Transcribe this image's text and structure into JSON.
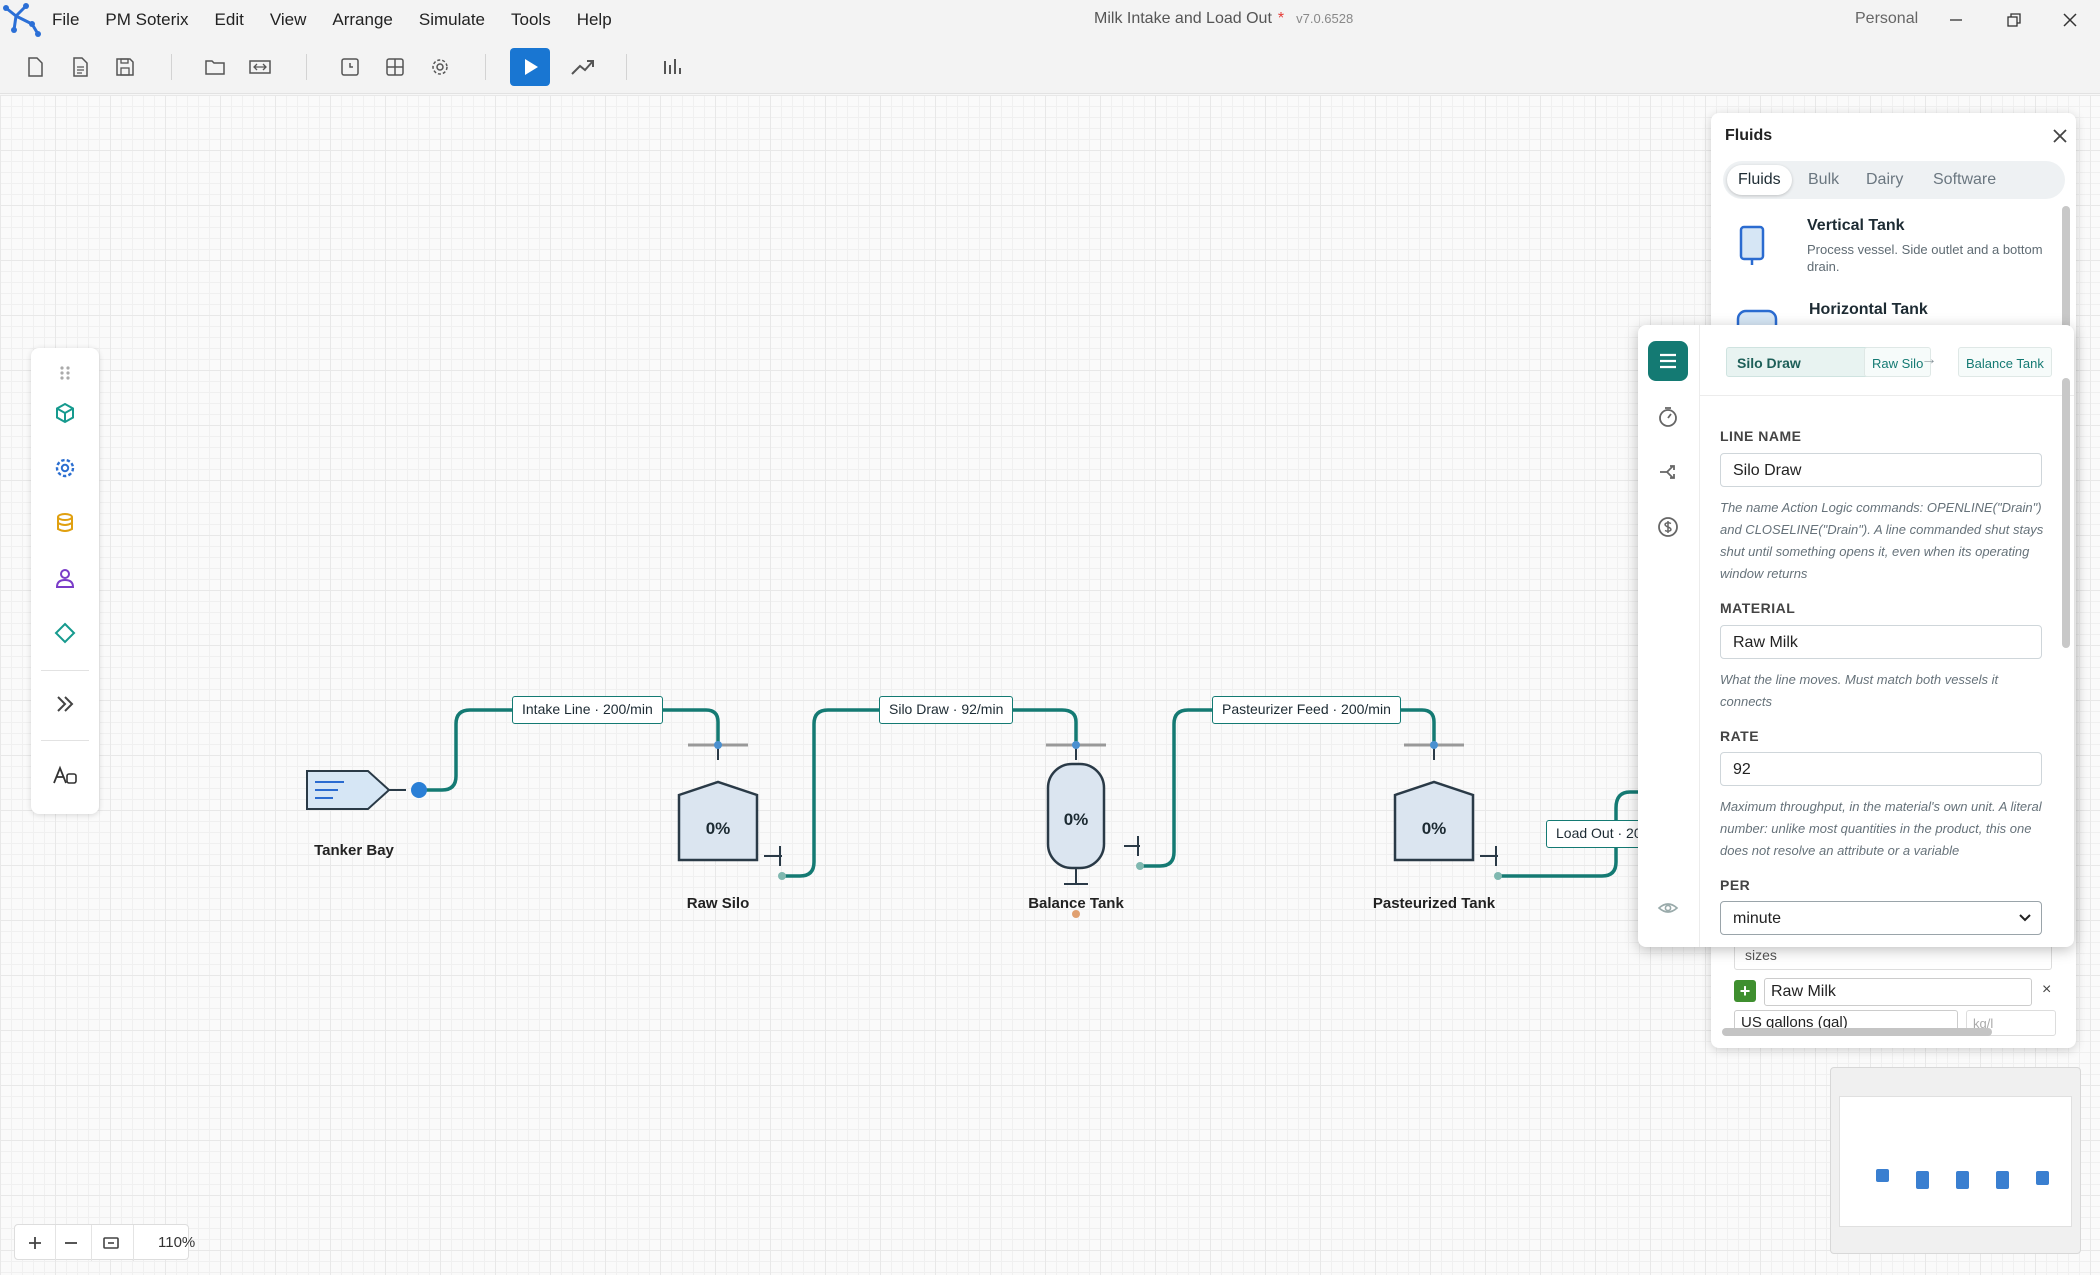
{
  "app": {
    "menu": [
      "File",
      "PM Soterix",
      "Edit",
      "View",
      "Arrange",
      "Simulate",
      "Tools",
      "Help"
    ],
    "title": "Milk Intake and Load Out",
    "dirty_marker": "*",
    "version": "v7.0.6528",
    "account": "Personal"
  },
  "toolbar": {
    "buttons": [
      "new-file",
      "new-document",
      "save",
      "open-folder",
      "import",
      "timer",
      "grid",
      "settings",
      "run-simulation",
      "trend-chart",
      "bar-chart"
    ],
    "accent_color": "#1976d2"
  },
  "palette": {
    "items": [
      "cube-icon",
      "gear-icon",
      "database-icon",
      "person-icon",
      "diamond-icon",
      "double-chevron-icon",
      "text-style-icon"
    ]
  },
  "flow": {
    "line_color": "#147a73",
    "nodes": [
      {
        "label": "Tanker Bay"
      },
      {
        "label": "Raw Silo",
        "level": "0%"
      },
      {
        "label": "Balance Tank",
        "level": "0%"
      },
      {
        "label": "Pasteurized Tank",
        "level": "0%"
      }
    ],
    "lines": [
      {
        "label": "Intake Line · 200/min"
      },
      {
        "label": "Silo Draw · 92/min"
      },
      {
        "label": "Pasteurizer Feed · 200/min"
      },
      {
        "label": "Load Out · 20"
      }
    ]
  },
  "fluids_panel": {
    "title": "Fluids",
    "tabs": [
      "Fluids",
      "Bulk",
      "Dairy",
      "Software"
    ],
    "active_tab": "Fluids",
    "shapes": [
      {
        "name": "Vertical Tank",
        "description": "Process vessel. Side outlet and a bottom drain."
      },
      {
        "name": "Horizontal Tank",
        "description": ""
      }
    ],
    "sub": {
      "sizes_label": "sizes",
      "material_value": "Raw Milk",
      "remove": "×",
      "unit_select": "US gallons (gal)",
      "density_placeholder": "kg/l"
    }
  },
  "inspector": {
    "line_name_chip": "Silo Draw",
    "from": "Raw Silo",
    "arrow": "→",
    "to": "Balance Tank",
    "fields": {
      "line_name_label": "LINE NAME",
      "line_name_value": "Silo Draw",
      "line_name_help": "The name Action Logic commands: OPENLINE(\"Drain\") and CLOSELINE(\"Drain\"). A line commanded shut stays shut until something opens it, even when its operating window returns",
      "material_label": "MATERIAL",
      "material_value": "Raw Milk",
      "material_help": "What the line moves. Must match both vessels it connects",
      "rate_label": "RATE",
      "rate_value": "92",
      "rate_help": "Maximum throughput, in the material's own unit. A literal number: unlike most quantities in the product, this one does not resolve an attribute or a variable",
      "per_label": "PER",
      "per_value": "minute"
    }
  },
  "zoom": {
    "level": "110%"
  }
}
